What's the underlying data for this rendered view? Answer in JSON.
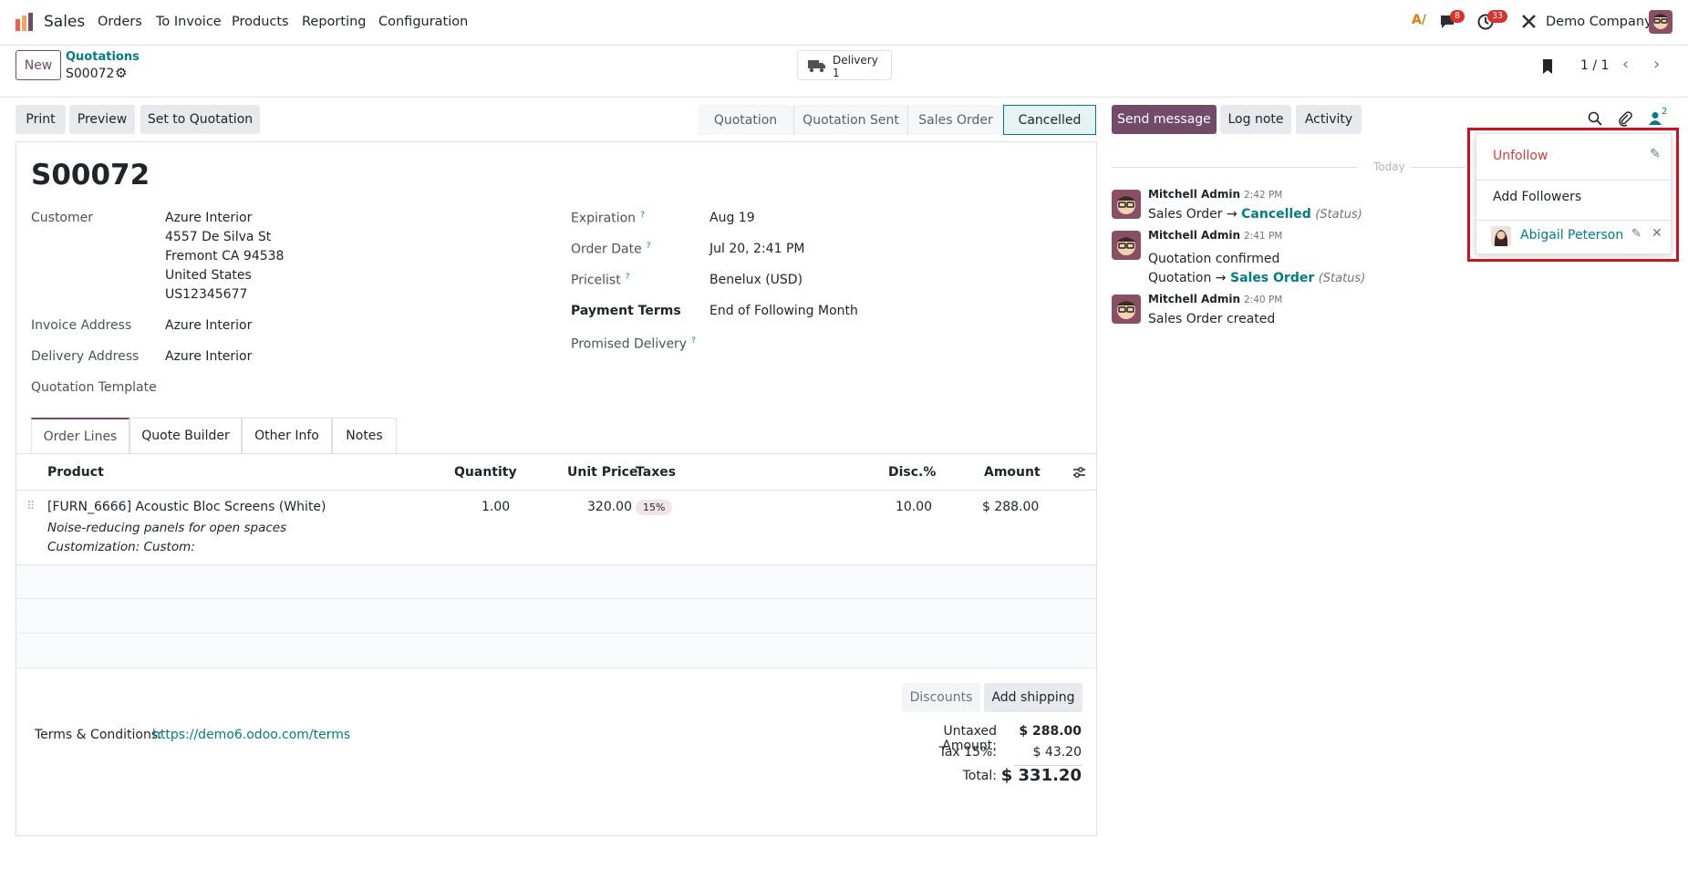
{
  "navbar": {
    "app_name": "Sales",
    "menu": [
      "Orders",
      "To Invoice",
      "Products",
      "Reporting",
      "Configuration"
    ],
    "messages_count": "8",
    "activities_count": "33",
    "company": "Demo Company"
  },
  "control_panel": {
    "new_label": "New",
    "breadcrumb_parent": "Quotations",
    "record_name": "S00072",
    "delivery_label": "Delivery",
    "delivery_count": "1",
    "pager": "1 / 1"
  },
  "actions": {
    "print": "Print",
    "preview": "Preview",
    "set_to_quotation": "Set to Quotation"
  },
  "statusbar": [
    "Quotation",
    "Quotation Sent",
    "Sales Order",
    "Cancelled"
  ],
  "form": {
    "title": "S00072",
    "customer_label": "Customer",
    "customer_name": "Azure Interior",
    "address": [
      "4557 De Silva St",
      "Fremont CA 94538",
      "United States",
      "US12345677"
    ],
    "invoice_address_label": "Invoice Address",
    "invoice_address": "Azure Interior",
    "delivery_address_label": "Delivery Address",
    "delivery_address": "Azure Interior",
    "quotation_template_label": "Quotation Template",
    "expiration_label": "Expiration",
    "expiration": "Aug 19",
    "order_date_label": "Order Date",
    "order_date": "Jul 20, 2:41 PM",
    "pricelist_label": "Pricelist",
    "pricelist": "Benelux (USD)",
    "payment_terms_label": "Payment Terms",
    "payment_terms": "End of Following Month",
    "promised_delivery_label": "Promised Delivery",
    "help_mark": "?"
  },
  "tabs": [
    "Order Lines",
    "Quote Builder",
    "Other Info",
    "Notes"
  ],
  "lines": {
    "headers": {
      "product": "Product",
      "quantity": "Quantity",
      "unit_price": "Unit Price",
      "taxes": "Taxes",
      "disc": "Disc.%",
      "amount": "Amount"
    },
    "row": {
      "product": "[FURN_6666] Acoustic Bloc Screens (White)",
      "desc1": "Noise-reducing panels for open spaces",
      "desc2": "Customization: Custom:",
      "quantity": "1.00",
      "unit_price": "320.00",
      "tax": "15%",
      "disc": "10.00",
      "amount": "$ 288.00"
    }
  },
  "footer": {
    "discounts": "Discounts",
    "add_shipping": "Add shipping",
    "terms_label": "Terms & Conditions:",
    "terms_link": "https://demo6.odoo.com/terms",
    "untaxed_label": "Untaxed Amount:",
    "untaxed": "$ 288.00",
    "tax_label": "Tax 15%:",
    "tax": "$ 43.20",
    "total_label": "Total:",
    "total": "$ 331.20"
  },
  "chatter": {
    "send_message": "Send message",
    "log_note": "Log note",
    "activity": "Activity",
    "followers_count": "2",
    "today": "Today",
    "messages": [
      {
        "author": "Mitchell Admin",
        "time": "2:42 PM",
        "prefix": "Sales Order →",
        "value": "Cancelled",
        "suffix": "(Status)"
      },
      {
        "author": "Mitchell Admin",
        "time": "2:41 PM",
        "text": "Quotation confirmed",
        "prefix": "Quotation →",
        "value": "Sales Order",
        "suffix": "(Status)"
      },
      {
        "author": "Mitchell Admin",
        "time": "2:40 PM",
        "text": "Sales Order created"
      }
    ]
  },
  "followers_menu": {
    "unfollow": "Unfollow",
    "add_followers": "Add Followers",
    "follower_name": "Abigail Peterson"
  },
  "colors": {
    "brand": "#714b67",
    "link": "#017e84",
    "badge": "#d9302c",
    "highlight": "#d10f1f"
  }
}
